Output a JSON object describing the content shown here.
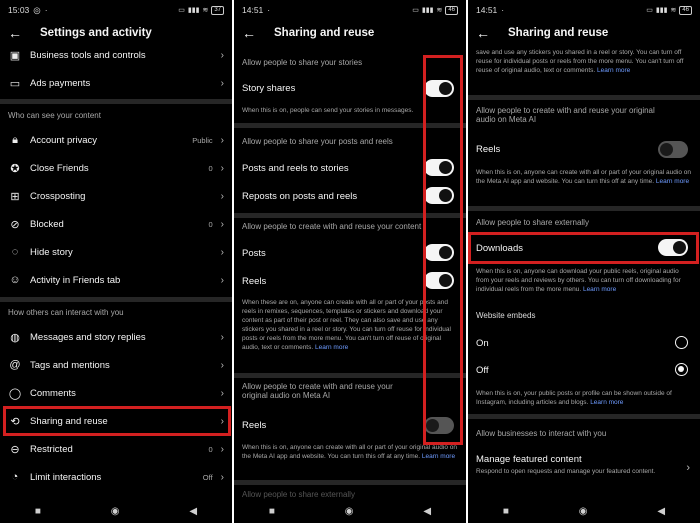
{
  "colors": {
    "background": "#000000",
    "highlight": "#d32020",
    "link": "#6e9bff"
  },
  "screen1": {
    "time": "15:03",
    "battery": "37",
    "title": "Settings and activity",
    "items_top": [
      {
        "label": "Business tools and controls",
        "icon": "briefcase-icon"
      },
      {
        "label": "Ads payments",
        "icon": "card-icon"
      }
    ],
    "section1": "Who can see your content",
    "items_mid": [
      {
        "label": "Account privacy",
        "value": "Public",
        "icon": "lock-icon"
      },
      {
        "label": "Close Friends",
        "value": "0",
        "icon": "star-icon"
      },
      {
        "label": "Crossposting",
        "value": "",
        "icon": "crosspost-icon"
      },
      {
        "label": "Blocked",
        "value": "0",
        "icon": "block-icon"
      },
      {
        "label": "Hide story",
        "value": "",
        "icon": "hide-story-icon"
      },
      {
        "label": "Activity in Friends tab",
        "value": "",
        "icon": "people-icon"
      }
    ],
    "section2": "How others can interact with you",
    "items_bottom": [
      {
        "label": "Messages and story replies",
        "value": "",
        "icon": "messenger-icon"
      },
      {
        "label": "Tags and mentions",
        "value": "",
        "icon": "at-icon"
      },
      {
        "label": "Comments",
        "value": "",
        "icon": "comment-icon"
      },
      {
        "label": "Sharing and reuse",
        "value": "",
        "icon": "share-icon"
      },
      {
        "label": "Restricted",
        "value": "0",
        "icon": "restricted-icon"
      },
      {
        "label": "Limit interactions",
        "value": "Off",
        "icon": "limit-icon"
      }
    ]
  },
  "screen2": {
    "time": "14:51",
    "battery": "46",
    "title": "Sharing and reuse",
    "sec_stories": "Allow people to share your stories",
    "story_shares": "Story shares",
    "story_shares_help": "When this is on, people can send your stories in messages.",
    "sec_posts": "Allow people to share your posts and reels",
    "posts_reels_stories": "Posts and reels to stories",
    "reposts": "Reposts on posts and reels",
    "sec_create": "Allow people to create with and reuse your content",
    "posts": "Posts",
    "reels": "Reels",
    "create_help": "When these are on, anyone can create with all or part of your posts and reels in remixes, sequences, templates or stickers and download your content as part of their post or reel. They can also save and use any stickers you shared in a reel or story. You can turn off reuse for individual posts or reels from the more menu. You can't turn off reuse of original audio, text or comments.",
    "learn_more": "Learn more",
    "sec_audio": "Allow people to create with and reuse your original audio on Meta AI",
    "reels_audio": "Reels",
    "audio_help": "When this is on, anyone can create with all or part of your original audio on the Meta AI app and website. You can turn this off at any time.",
    "partial_bottom": "Allow people to share externally"
  },
  "screen3": {
    "time": "14:51",
    "battery": "46",
    "title": "Sharing and reuse",
    "top_help": "save and use any stickers you shared in a reel or story. You can turn off reuse for individual posts or reels from the more menu. You can't turn off reuse of original audio, text or comments.",
    "learn_more": "Learn more",
    "sec_audio": "Allow people to create with and reuse your original audio on Meta AI",
    "reels": "Reels",
    "audio_help": "When this is on, anyone can create with all or part of your original audio on the Meta AI app and website. You can turn this off at any time.",
    "sec_external": "Allow people to share externally",
    "downloads": "Downloads",
    "downloads_help": "When this is on, anyone can download your public reels, original audio from your reels and reviews by others. You can turn off downloading for individual reels from the more menu.",
    "sec_embeds": "Website embeds",
    "on": "On",
    "off": "Off",
    "embeds_help": "When this is on, your public posts or profile can be shown outside of Instagram, including articles and blogs.",
    "sec_business": "Allow businesses to interact with you",
    "manage_featured": "Manage featured content",
    "manage_featured_help": "Respond to open requests and manage your featured content."
  }
}
